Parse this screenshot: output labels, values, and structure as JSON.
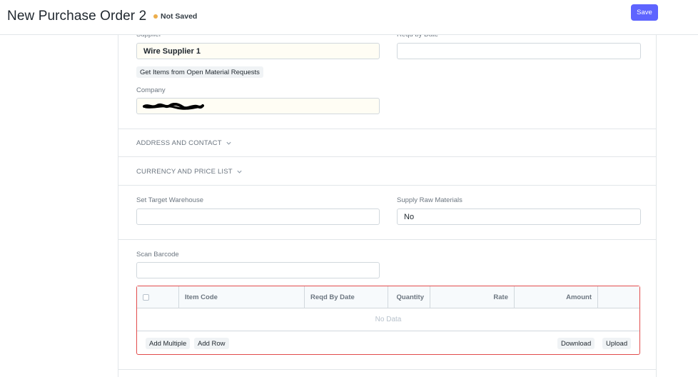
{
  "header": {
    "title": "New Purchase Order 2",
    "status": "Not Saved",
    "status_color": "#ECAD4B",
    "save_label": "Save",
    "accent_color": "#5e64ff"
  },
  "form": {
    "supplier": {
      "label": "Supplier",
      "value": "Wire Supplier 1"
    },
    "reqd_by_date": {
      "label": "Reqd by Date",
      "value": ""
    },
    "get_items_button": "Get Items from Open Material Requests",
    "company": {
      "label": "Company",
      "value": ""
    },
    "sections": {
      "address_contact": "ADDRESS AND CONTACT",
      "currency_price": "CURRENCY AND PRICE LIST"
    },
    "set_target_warehouse": {
      "label": "Set Target Warehouse",
      "value": ""
    },
    "supply_raw_materials": {
      "label": "Supply Raw Materials",
      "value": "No"
    },
    "scan_barcode": {
      "label": "Scan Barcode",
      "value": ""
    }
  },
  "items_table": {
    "columns": [
      "Item Code",
      "Reqd By Date",
      "Quantity",
      "Rate",
      "Amount"
    ],
    "empty_text": "No Data",
    "buttons": {
      "add_multiple": "Add Multiple",
      "add_row": "Add Row",
      "download": "Download",
      "upload": "Upload"
    },
    "error_border_color": "#e24c4c"
  }
}
